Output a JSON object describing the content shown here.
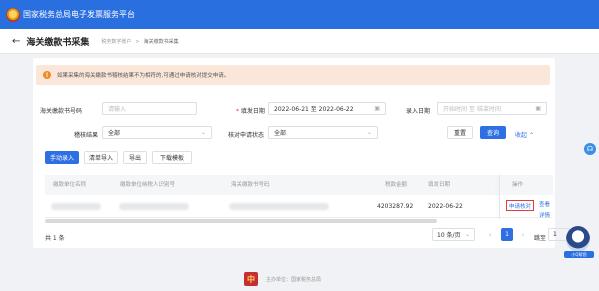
{
  "app": {
    "title": "国家税务总局电子发票服务平台"
  },
  "header": {
    "page_title": "海关缴款书采集",
    "breadcrumb": [
      "税务数字账户",
      "海关缴款书采集"
    ]
  },
  "notice": {
    "text": "如果采集的海关缴款书稽核结果不为相符的,可通过申请核对提交申请。"
  },
  "filters": {
    "doc_no_label": "海关缴款书号码",
    "doc_no_placeholder": "请输入",
    "fill_date_label": "填发日期",
    "fill_date_value": "2022-06-21 至 2022-06-22",
    "entry_date_label": "录入日期",
    "entry_date_start_placeholder": "开始时间",
    "entry_date_to": "至",
    "entry_date_end_placeholder": "结束时间",
    "audit_result_label": "稽核结果",
    "audit_result_value": "全部",
    "verify_status_label": "核对申请状态",
    "verify_status_value": "全部"
  },
  "actions": {
    "reset": "重置",
    "search": "查询",
    "collapse": "收起"
  },
  "toolbar": {
    "manual_entry": "手动录入",
    "list_import": "清单导入",
    "export": "导出",
    "download_template": "下载模板"
  },
  "table": {
    "columns": [
      "缴款单位名称",
      "缴款单位纳税人识别号",
      "海关缴款书号码",
      "税款金额",
      "填发日期",
      "操作"
    ],
    "rows": [
      {
        "amount": "4203287.92",
        "date": "2022-06-22",
        "op_apply": "申请核对",
        "op_detail": "查看详情"
      }
    ]
  },
  "pagination": {
    "total": "共 1 条",
    "page_size": "10 条/页",
    "current_page": "1",
    "goto_label": "跳至",
    "goto_value": "1",
    "goto_suffix": "页"
  },
  "footer": {
    "text": "主办单位：国家税务总局"
  },
  "assistant": {
    "badge": "小Q帮您"
  }
}
